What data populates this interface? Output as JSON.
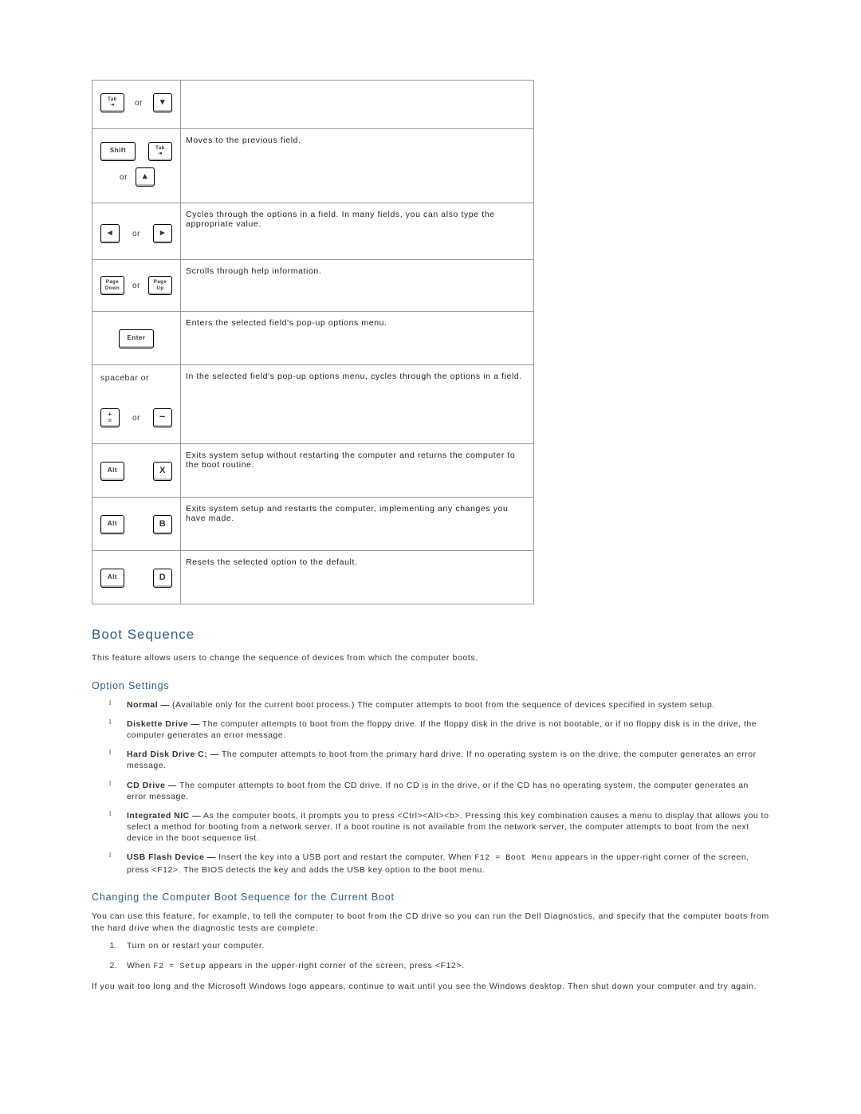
{
  "rows": [
    {
      "desc": ""
    },
    {
      "desc": "Moves to the previous field."
    },
    {
      "desc": "Cycles through the options in a field. In many fields, you can also type the appropriate value."
    },
    {
      "desc": "Scrolls through help information."
    },
    {
      "desc": "Enters the selected field's pop-up options menu."
    },
    {
      "spacebar": "spacebar or",
      "desc": "In the selected field's pop-up options menu, cycles through the options in a field."
    },
    {
      "desc": "Exits system setup without restarting the computer and returns the computer to the boot routine."
    },
    {
      "desc": "Exits system setup and restarts the computer, implementing any changes you have made."
    },
    {
      "desc": "Resets the selected option to the default."
    }
  ],
  "keys": {
    "tab": "Tab",
    "shift": "Shift",
    "pgdn": "Page\nDown",
    "pgup": "Page\nUp",
    "enter": "Enter",
    "alt": "Alt",
    "or": "or"
  },
  "headings": {
    "boot_sequence": "Boot Sequence",
    "option_settings": "Option Settings",
    "changing": "Changing the Computer Boot Sequence for the Current Boot"
  },
  "paragraphs": {
    "boot_intro": "This feature allows users to change the sequence of devices from which the computer boots.",
    "changing_intro": "You can use this feature, for example, to tell the computer to boot from the CD drive so you can run the Dell Diagnostics, and specify that the computer boots from the hard drive when the diagnostic tests are complete.",
    "wait_note": "If you wait too long and the Microsoft Windows logo appears, continue to wait until you see the Windows desktop. Then shut down your computer and try again."
  },
  "options": [
    {
      "term": "Normal —",
      "body": " (Available only for the current boot process.) The computer attempts to boot from the sequence of devices specified in system setup."
    },
    {
      "term": "Diskette Drive —",
      "body": " The computer attempts to boot from the floppy drive. If the floppy disk in the drive is not bootable, or if no floppy disk is in the drive, the computer generates an error message."
    },
    {
      "term": "Hard Disk Drive C: —",
      "body": " The computer attempts to boot from the primary hard drive. If no operating system is on the drive, the computer generates an error message."
    },
    {
      "term": "CD Drive —",
      "body": " The computer attempts to boot from the CD drive. If no CD is in the drive, or if the CD has no operating system, the computer generates an error message."
    },
    {
      "term": "Integrated NIC —",
      "body": " As the computer boots, it prompts you to press <Ctrl><Alt><b>. Pressing this key combination causes a menu to display that allows you to select a method for booting from a network server. If a boot routine is not available from the network server, the computer attempts to boot from the next device in the boot sequence list."
    },
    {
      "term": "USB Flash Device —",
      "body_pre": " Insert the key into a USB port and restart the computer. When ",
      "code": "F12 = Boot Menu",
      "body_post": " appears in the upper-right corner of the screen, press <F12>. The BIOS detects the key and adds the USB key option to the boot menu."
    }
  ],
  "steps": [
    {
      "text": "Turn on or restart your computer."
    },
    {
      "pre": "When ",
      "code": "F2 = Setup",
      "post": " appears in the upper-right corner of the screen, press <F12>."
    }
  ]
}
